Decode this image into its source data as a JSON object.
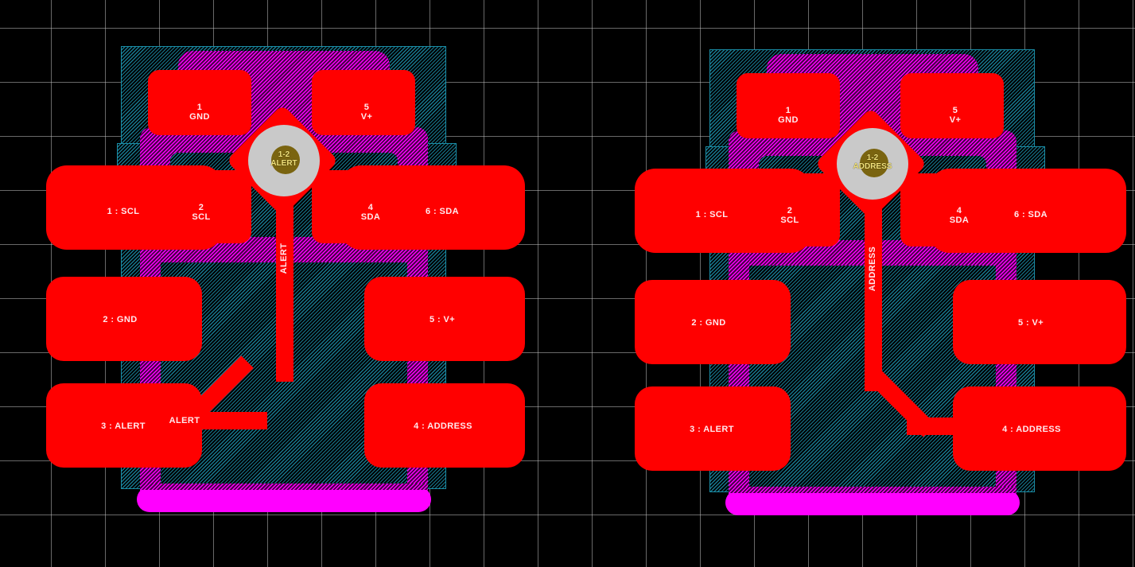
{
  "view": {
    "background_color": "#000000",
    "grid_color": "#bebebe",
    "grid_spacing_px": 68,
    "layer_colors": {
      "top_copper": "#ff0000",
      "bottom_copper": "#ff00ff",
      "courtyard_hatch": "#17788f",
      "courtyard_outline": "#1a8fa8",
      "via_barrel": "#c9c9c9",
      "via_label_bg": "#7a6410",
      "via_label_text": "#f2e27a",
      "pad_label_text": "#ffe9ee"
    }
  },
  "footprints": [
    {
      "id": "variant-alert",
      "net_name": "ALERT",
      "via": {
        "label_line1": "1-2",
        "label_line2": "ALERT"
      },
      "track_label": "ALERT",
      "track_label_vertical": "ALERT",
      "ic_pads": [
        {
          "number": "1",
          "net": "GND",
          "label_line1": "1",
          "label_line2": "GND"
        },
        {
          "number": "5",
          "net": "V+",
          "label_line1": "5",
          "label_line2": "V+"
        },
        {
          "number": "2",
          "net": "SCL",
          "label_line1": "2",
          "label_line2": "SCL"
        },
        {
          "number": "4",
          "net": "SDA",
          "label_line1": "4",
          "label_line2": "SDA"
        }
      ],
      "connector_pads": [
        {
          "label": "1 : SCL"
        },
        {
          "label": "6 : SDA"
        },
        {
          "label": "2 : GND"
        },
        {
          "label": "5 : V+"
        },
        {
          "label": "3 : ALERT"
        },
        {
          "label": "4 : ADDRESS"
        }
      ]
    },
    {
      "id": "variant-address",
      "net_name": "ADDRESS",
      "via": {
        "label_line1": "1-2",
        "label_line2": "ADDRESS"
      },
      "track_label": "",
      "track_label_vertical": "ADDRESS",
      "ic_pads": [
        {
          "number": "1",
          "net": "GND",
          "label_line1": "1",
          "label_line2": "GND"
        },
        {
          "number": "5",
          "net": "V+",
          "label_line1": "5",
          "label_line2": "V+"
        },
        {
          "number": "2",
          "net": "SCL",
          "label_line1": "2",
          "label_line2": "SCL"
        },
        {
          "number": "4",
          "net": "SDA",
          "label_line1": "4",
          "label_line2": "SDA"
        }
      ],
      "connector_pads": [
        {
          "label": "1 : SCL"
        },
        {
          "label": "6 : SDA"
        },
        {
          "label": "2 : GND"
        },
        {
          "label": "5 : V+"
        },
        {
          "label": "3 : ALERT"
        },
        {
          "label": "4 : ADDRESS"
        }
      ]
    }
  ]
}
